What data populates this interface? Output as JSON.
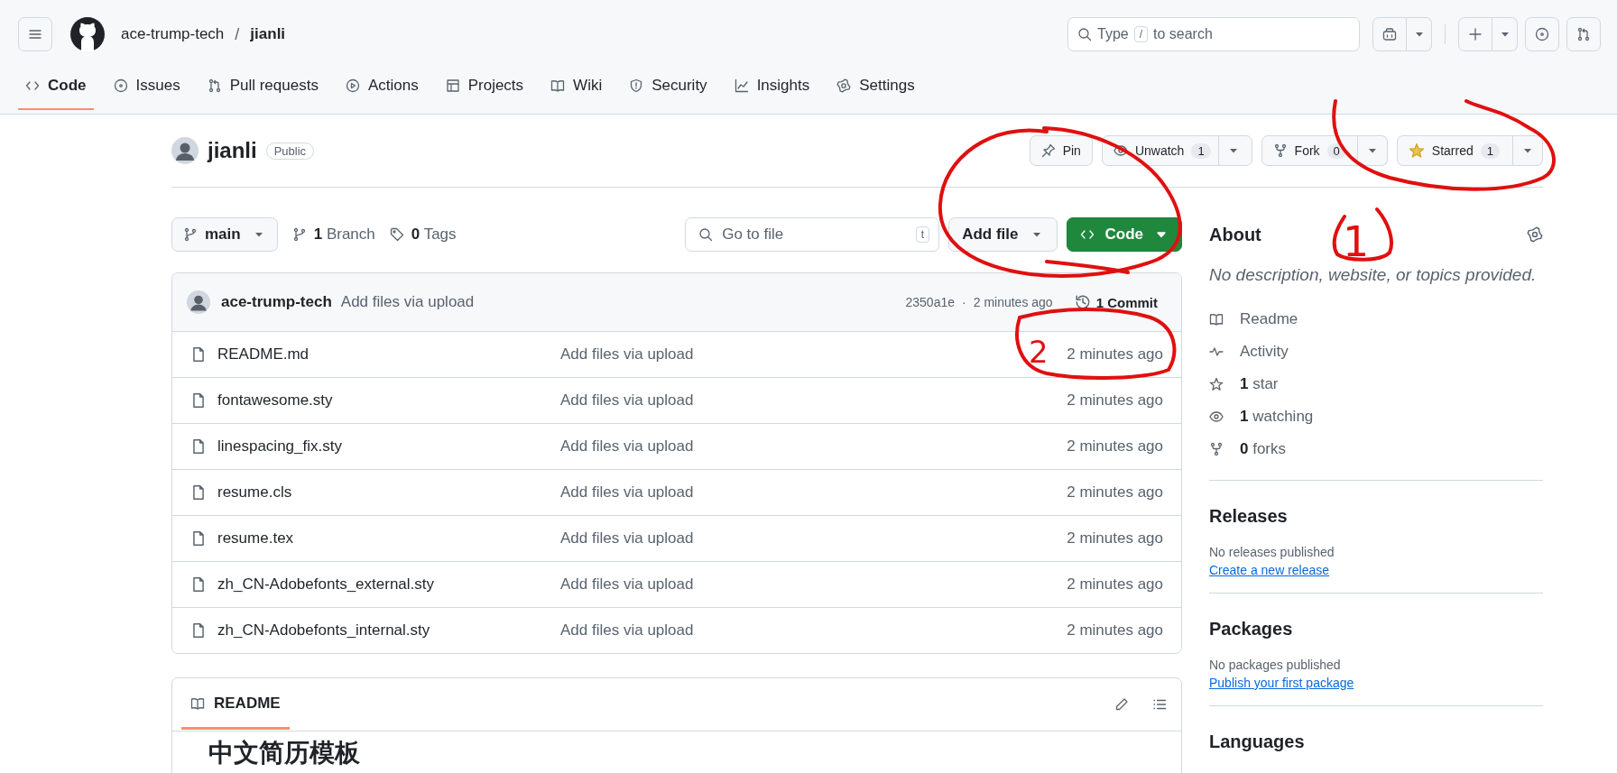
{
  "header": {
    "owner": "ace-trump-tech",
    "separator": "/",
    "repo": "jianli",
    "search": {
      "prefix": "Type",
      "key": "/",
      "suffix": "to search"
    }
  },
  "nav_tabs": [
    {
      "kind": "code",
      "label": "Code",
      "selected": true
    },
    {
      "kind": "issue",
      "label": "Issues",
      "selected": false
    },
    {
      "kind": "pr",
      "label": "Pull requests",
      "selected": false
    },
    {
      "kind": "play",
      "label": "Actions",
      "selected": false
    },
    {
      "kind": "table",
      "label": "Projects",
      "selected": false
    },
    {
      "kind": "book",
      "label": "Wiki",
      "selected": false
    },
    {
      "kind": "shield",
      "label": "Security",
      "selected": false
    },
    {
      "kind": "graph",
      "label": "Insights",
      "selected": false
    },
    {
      "kind": "gear",
      "label": "Settings",
      "selected": false
    }
  ],
  "repo": {
    "name": "jianli",
    "visibility": "Public"
  },
  "repo_actions": {
    "pin": "Pin",
    "watch": {
      "label": "Unwatch",
      "count": "1"
    },
    "fork": {
      "label": "Fork",
      "count": "0"
    },
    "star": {
      "label": "Starred",
      "count": "1",
      "starred": true
    }
  },
  "toolbar": {
    "branch": "main",
    "branches": "**1** Branch",
    "tags": "**0** Tags",
    "go_to_file": {
      "placeholder": "Go to file",
      "shortcut": "t"
    },
    "add_file": "Add file",
    "code": "Code"
  },
  "latest_commit": {
    "author": "ace-trump-tech",
    "message": "Add files via upload",
    "hash": "2350a1e",
    "separator": "·",
    "time": "2 minutes ago",
    "commits": "1 Commit"
  },
  "files": [
    {
      "name": "README.md",
      "message": "Add files via upload",
      "time": "2 minutes ago"
    },
    {
      "name": "fontawesome.sty",
      "message": "Add files via upload",
      "time": "2 minutes ago"
    },
    {
      "name": "linespacing_fix.sty",
      "message": "Add files via upload",
      "time": "2 minutes ago"
    },
    {
      "name": "resume.cls",
      "message": "Add files via upload",
      "time": "2 minutes ago"
    },
    {
      "name": "resume.tex",
      "message": "Add files via upload",
      "time": "2 minutes ago"
    },
    {
      "name": "zh_CN-Adobefonts_external.sty",
      "message": "Add files via upload",
      "time": "2 minutes ago"
    },
    {
      "name": "zh_CN-Adobefonts_internal.sty",
      "message": "Add files via upload",
      "time": "2 minutes ago"
    }
  ],
  "readme": {
    "tab": "README",
    "heading": "中文简历模板"
  },
  "about": {
    "title": "About",
    "description": "No description, website, or topics provided.",
    "links": [
      {
        "kind": "book",
        "label": "Readme"
      },
      {
        "kind": "pulse",
        "label": "Activity"
      },
      {
        "kind": "star",
        "label": "**1** star"
      },
      {
        "kind": "eye",
        "label": "**1** watching"
      },
      {
        "kind": "fork",
        "label": "**0** forks"
      }
    ]
  },
  "releases": {
    "title": "Releases",
    "empty": "No releases published",
    "link": "Create a new release"
  },
  "packages": {
    "title": "Packages",
    "empty": "No packages published",
    "link": "Publish your first package"
  },
  "languages": {
    "title": "Languages"
  },
  "annotations": [
    {
      "text": "1"
    },
    {
      "text": "2"
    }
  ]
}
